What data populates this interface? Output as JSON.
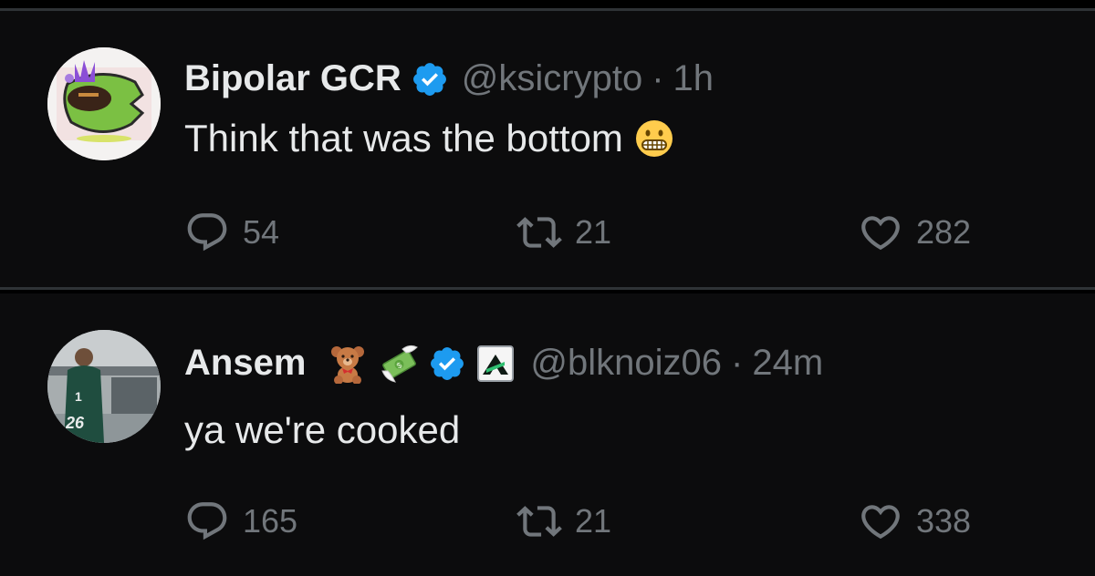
{
  "tweets": [
    {
      "display_name": "Bipolar GCR",
      "handle": "@ksicrypto",
      "time": "1h",
      "text": "Think that was the bottom",
      "verified": true,
      "text_emoji": "grimacing-face",
      "counts": {
        "replies": "54",
        "retweets": "21",
        "likes": "282"
      }
    },
    {
      "display_name": "Ansem",
      "handle": "@blknoiz06",
      "time": "24m",
      "text": "ya we're cooked",
      "verified": true,
      "name_emojis": [
        "teddy-bear",
        "money-with-wings"
      ],
      "affiliate_badge": "affiliate-logo",
      "counts": {
        "replies": "165",
        "retweets": "21",
        "likes": "338"
      }
    }
  ],
  "separator": "·",
  "colors": {
    "background": "#0c0c0d",
    "divider": "#2f3336",
    "primary_text": "#e7e9ea",
    "secondary_text": "#71767b",
    "verified_blue": "#1d9bf0"
  }
}
